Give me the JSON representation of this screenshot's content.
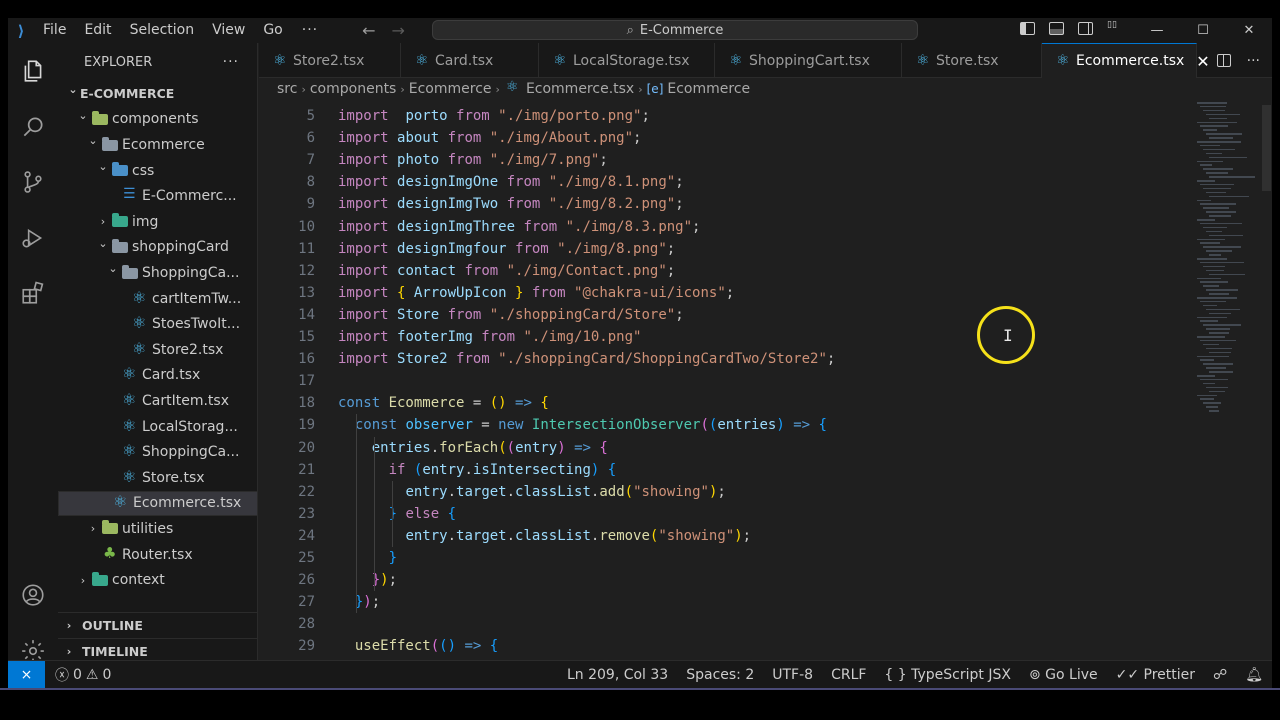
{
  "window": {
    "title": "E-Commerce"
  },
  "menu": [
    "File",
    "Edit",
    "Selection",
    "View",
    "Go"
  ],
  "menu_more": "···",
  "window_controls": {
    "minimize": "—",
    "maximize": "☐",
    "close": "✕"
  },
  "sidebar": {
    "header": "EXPLORER",
    "more": "···",
    "tree": [
      {
        "label": "E-COMMERCE",
        "depth": 0,
        "chevron": "down",
        "icon": "",
        "section": true
      },
      {
        "label": "components",
        "depth": 1,
        "chevron": "down",
        "icon": "folder-green"
      },
      {
        "label": "Ecommerce",
        "depth": 2,
        "chevron": "down",
        "icon": "folder"
      },
      {
        "label": "css",
        "depth": 3,
        "chevron": "down",
        "icon": "folder-blue"
      },
      {
        "label": "E-Commerc...",
        "depth": 4,
        "chevron": "",
        "icon": "css"
      },
      {
        "label": "img",
        "depth": 3,
        "chevron": "right",
        "icon": "folder-img"
      },
      {
        "label": "shoppingCard",
        "depth": 3,
        "chevron": "down",
        "icon": "folder"
      },
      {
        "label": "ShoppingCa...",
        "depth": 4,
        "chevron": "down",
        "icon": "folder"
      },
      {
        "label": "cartItemTw...",
        "depth": 5,
        "chevron": "",
        "icon": "react"
      },
      {
        "label": "StoesTwoIt...",
        "depth": 5,
        "chevron": "",
        "icon": "react"
      },
      {
        "label": "Store2.tsx",
        "depth": 5,
        "chevron": "",
        "icon": "react"
      },
      {
        "label": "Card.tsx",
        "depth": 4,
        "chevron": "",
        "icon": "react"
      },
      {
        "label": "CartItem.tsx",
        "depth": 4,
        "chevron": "",
        "icon": "react"
      },
      {
        "label": "LocalStorag...",
        "depth": 4,
        "chevron": "",
        "icon": "react"
      },
      {
        "label": "ShoppingCa...",
        "depth": 4,
        "chevron": "",
        "icon": "react"
      },
      {
        "label": "Store.tsx",
        "depth": 4,
        "chevron": "",
        "icon": "react"
      },
      {
        "label": "Ecommerce.tsx",
        "depth": 3,
        "chevron": "",
        "icon": "react",
        "selected": true
      },
      {
        "label": "utilities",
        "depth": 2,
        "chevron": "right",
        "icon": "folder-green"
      },
      {
        "label": "Router.tsx",
        "depth": 2,
        "chevron": "",
        "icon": "tsx-green"
      },
      {
        "label": "context",
        "depth": 1,
        "chevron": "right",
        "icon": "folder-img"
      }
    ],
    "outline": "OUTLINE",
    "timeline": "TIMELINE"
  },
  "tabs": [
    {
      "label": "Store2.tsx",
      "active": false
    },
    {
      "label": "Card.tsx",
      "active": false
    },
    {
      "label": "LocalStorage.tsx",
      "active": false
    },
    {
      "label": "ShoppingCart.tsx",
      "active": false
    },
    {
      "label": "Store.tsx",
      "active": false
    },
    {
      "label": "Ecommerce.tsx",
      "active": true
    }
  ],
  "tab_close": "✕",
  "editor_more": "···",
  "breadcrumb": [
    "src",
    "components",
    "Ecommerce",
    "Ecommerce.tsx",
    "Ecommerce"
  ],
  "code": [
    {
      "n": "5",
      "t": [
        [
          "kw2",
          "import"
        ],
        [
          "",
          "  "
        ],
        [
          "var",
          "porto"
        ],
        [
          "",
          ""
        ],
        [
          "kw2",
          " from "
        ],
        [
          "str",
          "\"./img/porto.png\""
        ],
        [
          "",
          ";"
        ]
      ]
    },
    {
      "n": "6",
      "t": [
        [
          "kw2",
          "import "
        ],
        [
          "var",
          "about"
        ],
        [
          "kw2",
          " from "
        ],
        [
          "str",
          "\"./img/About.png\""
        ],
        [
          "",
          ";"
        ]
      ]
    },
    {
      "n": "7",
      "t": [
        [
          "kw2",
          "import "
        ],
        [
          "var",
          "photo"
        ],
        [
          "kw2",
          " from "
        ],
        [
          "str",
          "\"./img/7.png\""
        ],
        [
          "",
          ";"
        ]
      ]
    },
    {
      "n": "8",
      "t": [
        [
          "kw2",
          "import "
        ],
        [
          "var",
          "designImgOne"
        ],
        [
          "kw2",
          " from "
        ],
        [
          "str",
          "\"./img/8.1.png\""
        ],
        [
          "",
          ";"
        ]
      ]
    },
    {
      "n": "9",
      "t": [
        [
          "kw2",
          "import "
        ],
        [
          "var",
          "designImgTwo"
        ],
        [
          "kw2",
          " from "
        ],
        [
          "str",
          "\"./img/8.2.png\""
        ],
        [
          "",
          ";"
        ]
      ]
    },
    {
      "n": "10",
      "t": [
        [
          "kw2",
          "import "
        ],
        [
          "var",
          "designImgThree"
        ],
        [
          "kw2",
          " from "
        ],
        [
          "str",
          "\"./img/8.3.png\""
        ],
        [
          "",
          ";"
        ]
      ]
    },
    {
      "n": "11",
      "t": [
        [
          "kw2",
          "import "
        ],
        [
          "var",
          "designImgfour"
        ],
        [
          "kw2",
          " from "
        ],
        [
          "str",
          "\"./img/8.png\""
        ],
        [
          "",
          ";"
        ]
      ]
    },
    {
      "n": "12",
      "t": [
        [
          "kw2",
          "import "
        ],
        [
          "var",
          "contact"
        ],
        [
          "kw2",
          " from "
        ],
        [
          "str",
          "\"./img/Contact.png\""
        ],
        [
          "",
          ";"
        ]
      ]
    },
    {
      "n": "13",
      "t": [
        [
          "kw2",
          "import "
        ],
        [
          "p1",
          "{"
        ],
        [
          "var",
          " ArrowUpIcon "
        ],
        [
          "p1",
          "}"
        ],
        [
          "kw2",
          " from "
        ],
        [
          "str",
          "\"@chakra-ui/icons\""
        ],
        [
          "",
          ";"
        ]
      ]
    },
    {
      "n": "14",
      "t": [
        [
          "kw2",
          "import "
        ],
        [
          "var",
          "Store"
        ],
        [
          "kw2",
          " from "
        ],
        [
          "str",
          "\"./shoppingCard/Store\""
        ],
        [
          "",
          ";"
        ]
      ]
    },
    {
      "n": "15",
      "t": [
        [
          "kw2",
          "import "
        ],
        [
          "var",
          "footerImg"
        ],
        [
          "kw2",
          " from "
        ],
        [
          "str",
          "\"./img/10.png\""
        ]
      ]
    },
    {
      "n": "16",
      "t": [
        [
          "kw2",
          "import "
        ],
        [
          "var",
          "Store2"
        ],
        [
          "kw2",
          " from "
        ],
        [
          "str",
          "\"./shoppingCard/ShoppingCardTwo/Store2\""
        ],
        [
          "",
          ";"
        ]
      ]
    },
    {
      "n": "17",
      "t": []
    },
    {
      "n": "18",
      "t": [
        [
          "kw",
          "const "
        ],
        [
          "fn",
          "Ecommerce"
        ],
        [
          "",
          " = "
        ],
        [
          "p1",
          "()"
        ],
        [
          "kw",
          " =>"
        ],
        [
          "",
          " "
        ],
        [
          "p1",
          "{"
        ]
      ]
    },
    {
      "n": "19",
      "t": [
        [
          "",
          "  "
        ],
        [
          "kw",
          "const "
        ],
        [
          "const",
          "observer"
        ],
        [
          "",
          " = "
        ],
        [
          "kw",
          "new "
        ],
        [
          "cls",
          "IntersectionObserver"
        ],
        [
          "p2",
          "("
        ],
        [
          "p3",
          "("
        ],
        [
          "var",
          "entries"
        ],
        [
          "p3",
          ")"
        ],
        [
          "kw",
          " =>"
        ],
        [
          "",
          " "
        ],
        [
          "p3",
          "{"
        ]
      ]
    },
    {
      "n": "20",
      "t": [
        [
          "",
          "    "
        ],
        [
          "var",
          "entries"
        ],
        [
          "",
          "."
        ],
        [
          "fn",
          "forEach"
        ],
        [
          "p1",
          "("
        ],
        [
          "p2",
          "("
        ],
        [
          "var",
          "entry"
        ],
        [
          "p2",
          ")"
        ],
        [
          "kw",
          " =>"
        ],
        [
          "",
          " "
        ],
        [
          "p2",
          "{"
        ]
      ]
    },
    {
      "n": "21",
      "t": [
        [
          "",
          "      "
        ],
        [
          "kw2",
          "if "
        ],
        [
          "p3",
          "("
        ],
        [
          "var",
          "entry"
        ],
        [
          "",
          "."
        ],
        [
          "var",
          "isIntersecting"
        ],
        [
          "p3",
          ")"
        ],
        [
          "",
          " "
        ],
        [
          "p3",
          "{"
        ]
      ]
    },
    {
      "n": "22",
      "t": [
        [
          "",
          "        "
        ],
        [
          "var",
          "entry"
        ],
        [
          "",
          "."
        ],
        [
          "var",
          "target"
        ],
        [
          "",
          "."
        ],
        [
          "var",
          "classList"
        ],
        [
          "",
          "."
        ],
        [
          "fn",
          "add"
        ],
        [
          "p1",
          "("
        ],
        [
          "str",
          "\"showing\""
        ],
        [
          "p1",
          ")"
        ],
        [
          "",
          ";"
        ]
      ]
    },
    {
      "n": "23",
      "t": [
        [
          "",
          "      "
        ],
        [
          "p3",
          "}"
        ],
        [
          "kw2",
          " else "
        ],
        [
          "p3",
          "{"
        ]
      ]
    },
    {
      "n": "24",
      "t": [
        [
          "",
          "        "
        ],
        [
          "var",
          "entry"
        ],
        [
          "",
          "."
        ],
        [
          "var",
          "target"
        ],
        [
          "",
          "."
        ],
        [
          "var",
          "classList"
        ],
        [
          "",
          "."
        ],
        [
          "fn",
          "remove"
        ],
        [
          "p1",
          "("
        ],
        [
          "str",
          "\"showing\""
        ],
        [
          "p1",
          ")"
        ],
        [
          "",
          ";"
        ]
      ]
    },
    {
      "n": "25",
      "t": [
        [
          "",
          "      "
        ],
        [
          "p3",
          "}"
        ]
      ]
    },
    {
      "n": "26",
      "t": [
        [
          "",
          "    "
        ],
        [
          "p2",
          "}"
        ],
        [
          "p1",
          ")"
        ],
        [
          "",
          ";"
        ]
      ]
    },
    {
      "n": "27",
      "t": [
        [
          "",
          "  "
        ],
        [
          "p3",
          "}"
        ],
        [
          "p2",
          ")"
        ],
        [
          "",
          ";"
        ]
      ]
    },
    {
      "n": "28",
      "t": []
    },
    {
      "n": "29",
      "t": [
        [
          "",
          "  "
        ],
        [
          "fn",
          "useEffect"
        ],
        [
          "p2",
          "("
        ],
        [
          "p3",
          "()"
        ],
        [
          "kw",
          " =>"
        ],
        [
          "",
          " "
        ],
        [
          "p3",
          "{"
        ]
      ]
    }
  ],
  "status": {
    "errors": "0",
    "warnings": "0",
    "position": "Ln 209, Col 33",
    "spaces": "Spaces: 2",
    "encoding": "UTF-8",
    "eol": "CRLF",
    "language": "TypeScript JSX",
    "language_prefix": "{ }",
    "golive": "Go Live",
    "prettier": "Prettier"
  },
  "colors": {
    "accent": "#0078d4",
    "cursor_ring": "#f5e11a"
  },
  "icons": [
    "files-icon",
    "search-icon",
    "source-control-icon",
    "run-debug-icon",
    "extensions-icon",
    "account-icon",
    "settings-gear-icon"
  ]
}
